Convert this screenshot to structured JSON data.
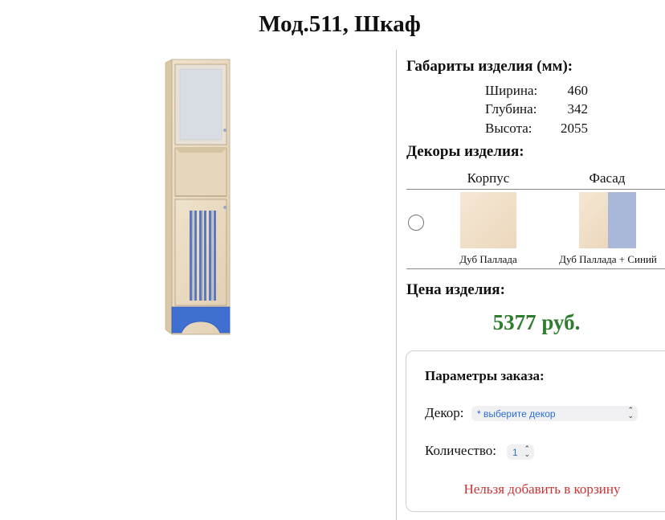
{
  "page_title": "Мод.511, Шкаф",
  "dimensions": {
    "heading": "Габариты изделия (мм):",
    "rows": [
      {
        "label": "Ширина:",
        "value": "460"
      },
      {
        "label": "Глубина:",
        "value": "342"
      },
      {
        "label": "Высота:",
        "value": "2055"
      }
    ]
  },
  "decors": {
    "heading": "Декоры изделия:",
    "columns": [
      "Корпус",
      "Фасад"
    ],
    "option": {
      "body_caption": "Дуб Паллада",
      "facade_caption": "Дуб Паллада + Синий",
      "colors": {
        "oak": "#f2dfc6",
        "blue": "#a9b8d8"
      }
    }
  },
  "price": {
    "heading": "Цена изделия:",
    "value": "5377 руб.",
    "color": "#2e7d2e"
  },
  "order": {
    "heading": "Параметры заказа:",
    "decor_label": "Декор:",
    "decor_select": "* выберите декор",
    "quantity_label": "Количество:",
    "quantity_select": "1",
    "error": "Нельзя добавить в корзину"
  }
}
